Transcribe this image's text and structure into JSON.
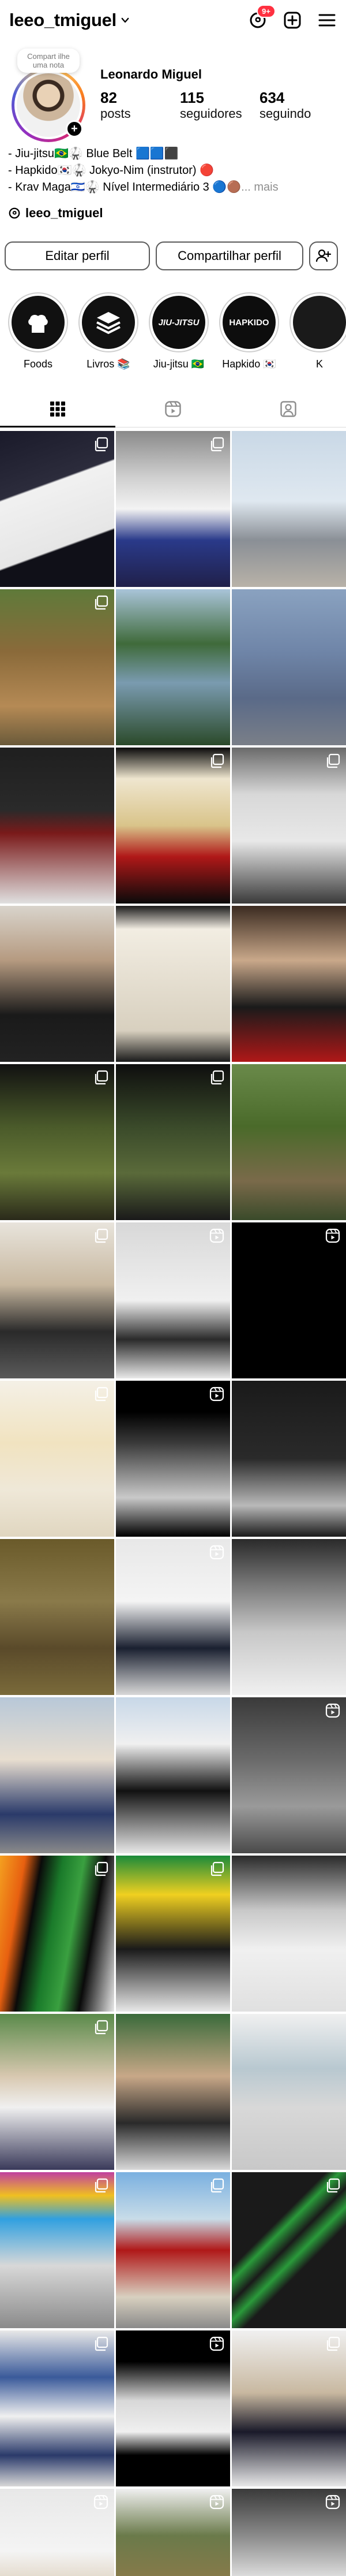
{
  "topbar": {
    "username": "leeo_tmiguel",
    "notification_count": "9+",
    "icons": [
      "threads-icon",
      "plus-square-icon",
      "menu-icon"
    ]
  },
  "profile": {
    "note_text": "Compart ilhe uma nota",
    "display_name": "Leonardo Miguel",
    "stats": [
      {
        "num": "82",
        "label": "posts"
      },
      {
        "num": "115",
        "label": "seguidores"
      },
      {
        "num": "634",
        "label": "seguindo"
      }
    ],
    "bio": [
      "- Jiu-jitsu🇧🇷🥋 Blue Belt 🟦🟦⬛",
      "- Hapkido🇰🇷🥋 Jokyo-Nim (instrutor) 🔴",
      "- Krav Maga🇮🇱🥋 Nível Intermediário 3 🔵🟤"
    ],
    "bio_more": "... mais",
    "threads_handle": "leeo_tmiguel"
  },
  "buttons": {
    "edit": "Editar perfil",
    "share": "Compartilhar perfil"
  },
  "highlights": [
    {
      "label": "Foods",
      "img_text": "",
      "icon": "chef-hat-icon"
    },
    {
      "label": "Livros 📚",
      "img_text": "",
      "icon": "book-stack-icon"
    },
    {
      "label": "Jiu-jitsu 🇧🇷",
      "img_text": "JIU-JITSU",
      "icon": ""
    },
    {
      "label": "Hapkido 🇰🇷",
      "img_text": "HAPKIDO",
      "icon": ""
    },
    {
      "label": "K",
      "img_text": "",
      "icon": ""
    }
  ],
  "tabs": [
    "grid-icon",
    "reels-icon",
    "tagged-icon"
  ],
  "grid": [
    {
      "bg": "linear-gradient(160deg,#1a1a2a 0%,#2c2c3c 35%,#f1f1f1 36%,#e6e6e6 70%,#101018 71%)",
      "badge": "carousel-icon"
    },
    {
      "bg": "linear-gradient(180deg,#8a8a8a 0%,#d0d0d0 30%,#f3f3f3 50%,#2a3a8a 70%,#20204a 100%)",
      "badge": "carousel-icon"
    },
    {
      "bg": "linear-gradient(180deg,#c9d8e6 0%,#dfe8f0 45%,#8a8f96 70%,#b8b2a8 100%)",
      "badge": ""
    },
    {
      "bg": "linear-gradient(180deg,#5f7a3a 0%,#8a6a3a 40%,#b58a55 75%,#6a5a3a 100%)",
      "badge": "carousel-icon"
    },
    {
      "bg": "linear-gradient(180deg,#a9c4d9 0%,#3f6a3a 35%,#7a9bb0 60%,#2b4a2a 100%)",
      "badge": ""
    },
    {
      "bg": "linear-gradient(180deg,#8aa2c0 0%,#6f85a8 40%,#5a6a88 70%,#7a7f88 100%)",
      "badge": ""
    },
    {
      "bg": "linear-gradient(180deg,#1f1f1f 0%,#2a2a2a 40%,#7a1a1a 55%,#e0e0e0 100%)",
      "badge": ""
    },
    {
      "bg": "linear-gradient(180deg,#0a0a0a 0%,#efe6cf 20%,#d9c48a 50%,#b01818 70%,#0a0a0a 100%)",
      "badge": "carousel-icon"
    },
    {
      "bg": "linear-gradient(180deg,#6a6a6a 0%,#d8d8d8 30%,#e8e8e8 60%,#3a3a3a 100%)",
      "badge": "carousel-icon"
    },
    {
      "bg": "linear-gradient(180deg,#d9d4cc 0%,#b59a80 35%,#1a1a1a 70%,#222 100%)",
      "badge": ""
    },
    {
      "bg": "linear-gradient(180deg,#1a1a1a 0%,#f2ede2 15%,#d8d0bf 80%,#1a1a1a 100%)",
      "badge": ""
    },
    {
      "bg": "linear-gradient(180deg,#3a2a20 0%,#c9a88a 35%,#1a1a1a 65%,#b01818 100%)",
      "badge": ""
    },
    {
      "bg": "linear-gradient(180deg,#111 0%,#4a5a2a 40%,#6a7a3a 70%,#2a2a1a 100%)",
      "badge": "carousel-icon"
    },
    {
      "bg": "linear-gradient(180deg,#0e0e0e 0%,#3a4a2a 40%,#5a6a3a 70%,#1a1a1a 100%)",
      "badge": "carousel-icon"
    },
    {
      "bg": "linear-gradient(180deg,#6a8a4a 0%,#4a6a2a 40%,#7a6a4a 75%,#3a4a2a 100%)",
      "badge": ""
    },
    {
      "bg": "linear-gradient(180deg,#e8e4dc 0%,#c8b8a0 40%,#2a2a2a 70%,#5a5a5a 100%)",
      "badge": "carousel-icon"
    },
    {
      "bg": "linear-gradient(180deg,#d8d8d8 0%,#f0f0f0 50%,#2a2a2a 75%,#e8e8e8 100%)",
      "badge": "reel-icon"
    },
    {
      "bg": "linear-gradient(180deg,#000 0%,#000 100%)",
      "badge": "reel-icon"
    },
    {
      "bg": "linear-gradient(180deg,#f4f0e6 0%,#f1e3c0 40%,#efe8d8 70%,#e0d6c0 100%)",
      "badge": "carousel-icon"
    },
    {
      "bg": "linear-gradient(180deg,#000 0%,#000 20%,#3a3a3a 40%,#c9c9c9 75%,#000 100%)",
      "badge": "reel-icon"
    },
    {
      "bg": "linear-gradient(180deg,#1a1a1a 0%,#2a2a2a 50%,#b9b9b9 80%,#1a1a1a 100%)",
      "badge": ""
    },
    {
      "bg": "linear-gradient(180deg,#6a5a2a 0%,#8a7a4a 40%,#5a4a2a 70%,#7a6a3a 100%)",
      "badge": ""
    },
    {
      "bg": "linear-gradient(180deg,#e8e8e8 0%,#f4f4f4 40%,#1a2030 70%,#d8d8d8 100%)",
      "badge": "reel-icon"
    },
    {
      "bg": "linear-gradient(180deg,#2a2a2a 0%,#7a7a7a 30%,#c8c8c8 60%,#f0f0f0 100%)",
      "badge": ""
    },
    {
      "bg": "linear-gradient(180deg,#b8c8d8 0%,#e8ded0 40%,#2a3a6a 75%,#8a8a8a 100%)",
      "badge": ""
    },
    {
      "bg": "linear-gradient(180deg,#c8d8e8 0%,#f0f0f0 30%,#111 60%,#e8e8e8 100%)",
      "badge": ""
    },
    {
      "bg": "linear-gradient(180deg,#3a3a3a 0%,#6a6a6a 40%,#9a9a9a 70%,#4a4a4a 100%)",
      "badge": "reel-icon"
    },
    {
      "bg": "linear-gradient(100deg,#f4a020 0%,#e86010 18%,#0a0a0a 30%,#1a7a2a 45%,#3aa040 60%,#0a0a0a 75%,#e8e8e8 100%)",
      "badge": "carousel-icon"
    },
    {
      "bg": "linear-gradient(180deg,#1a8a3a 0%,#f0d020 25%,#1a1a1a 60%,#e8e8e8 100%)",
      "badge": "carousel-icon"
    },
    {
      "bg": "linear-gradient(180deg,#2a2a2a 0%,#c8c8c8 35%,#f0f0f0 60%,#e0e0e0 100%)",
      "badge": ""
    },
    {
      "bg": "linear-gradient(180deg,#5a8a4a 0%,#d8c8b0 40%,#f0f0f0 60%,#3a3a5a 100%)",
      "badge": "carousel-icon"
    },
    {
      "bg": "linear-gradient(180deg,#3a6a3a 0%,#c8a888 40%,#2a2a2a 70%,#d8d8d8 100%)",
      "badge": ""
    },
    {
      "bg": "linear-gradient(180deg,#f0f0f0 0%,#b8c8d0 35%,#d8d8d8 60%,#c8c8c8 100%)",
      "badge": ""
    },
    {
      "bg": "linear-gradient(180deg,#c040a0 0%,#f0c020 15%,#30a0e0 30%,#d8d8d8 60%,#8a8a8a 100%)",
      "badge": "carousel-icon"
    },
    {
      "bg": "linear-gradient(180deg,#7ab0e0 0%,#c8dce8 30%,#b01818 50%,#d8d0c0 80%,#8a8a8a 100%)",
      "badge": "carousel-icon"
    },
    {
      "bg": "linear-gradient(135deg,#1a1a1a 0%,#1a1a1a 35%,#2a9a3a 40%,#1a1a1a 48%,#2a9a3a 55%,#1a1a1a 62%,#1a1a1a 100%)",
      "badge": "carousel-icon"
    },
    {
      "bg": "linear-gradient(180deg,#e8e8e8 0%,#3a5a9a 30%,#f0f0f0 55%,#2a3a6a 80%,#d8d8d8 100%)",
      "badge": "carousel-icon"
    },
    {
      "bg": "linear-gradient(180deg,#000 0%,#000 20%,#d8d8d8 45%,#f0f0f0 65%,#000 80%)",
      "badge": "reel-icon"
    },
    {
      "bg": "linear-gradient(180deg,#f0f0f0 0%,#c8b8a0 40%,#1a1a2a 65%,#e8e8e8 100%)",
      "badge": "carousel-icon"
    },
    {
      "bg": "linear-gradient(180deg,#e8e8e8 0%,#f4f4f4 40%,#d8c8b0 70%,#c8c8c8 100%)",
      "badge": "reel-icon"
    },
    {
      "bg": "linear-gradient(180deg,#f0f0f0 0%,#6a7a4a 30%,#8a7a4a 60%,#5a6a3a 100%)",
      "badge": "reel-icon"
    },
    {
      "bg": "linear-gradient(180deg,#3a3a3a 0%,#8a8a8a 30%,#e8e8e8 60%,#6a6a6a 100%)",
      "badge": "reel-icon"
    }
  ]
}
